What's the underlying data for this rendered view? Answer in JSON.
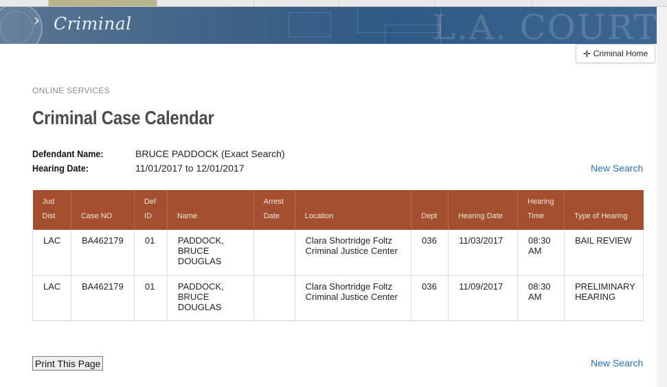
{
  "banner": {
    "section_title": "Criminal",
    "watermark": "L.A. COURT"
  },
  "home_button": {
    "icon": "crosshair-move-icon",
    "label": "Criminal Home"
  },
  "page": {
    "eyebrow": "ONLINE SERVICES",
    "title": "Criminal Case Calendar"
  },
  "search_info": {
    "defendant_label": "Defendant Name:",
    "defendant_value": "BRUCE PADDOCK (Exact Search)",
    "hearing_label": "Hearing Date:",
    "hearing_value": "11/01/2017 to 12/01/2017"
  },
  "links": {
    "new_search_top": "New Search",
    "new_search_bottom": "New Search"
  },
  "table": {
    "columns": [
      {
        "line1": "Jud",
        "line2": "Dist"
      },
      {
        "line1": "",
        "line2": "Case NO"
      },
      {
        "line1": "Def",
        "line2": "ID"
      },
      {
        "line1": "",
        "line2": "Name"
      },
      {
        "line1": "Arrest",
        "line2": "Date"
      },
      {
        "line1": "",
        "line2": "Location"
      },
      {
        "line1": "",
        "line2": "Dept"
      },
      {
        "line1": "",
        "line2": "Hearing Date"
      },
      {
        "line1": "Hearing",
        "line2": "Time"
      },
      {
        "line1": "",
        "line2": "Type of Hearing"
      }
    ],
    "rows": [
      {
        "jud_dist": "LAC",
        "case_no": "BA462179",
        "def_id": "01",
        "name_lines": [
          "PADDOCK,",
          "BRUCE",
          "DOUGLAS"
        ],
        "arrest_date": "",
        "location_lines": [
          "Clara Shortridge Foltz",
          "Criminal Justice Center"
        ],
        "dept": "036",
        "hearing_date": "11/03/2017",
        "time_lines": [
          "08:30",
          "AM"
        ],
        "type_lines": [
          "BAIL REVIEW"
        ]
      },
      {
        "jud_dist": "LAC",
        "case_no": "BA462179",
        "def_id": "01",
        "name_lines": [
          "PADDOCK,",
          "BRUCE",
          "DOUGLAS"
        ],
        "arrest_date": "",
        "location_lines": [
          "Clara Shortridge Foltz",
          "Criminal Justice Center"
        ],
        "dept": "036",
        "hearing_date": "11/09/2017",
        "time_lines": [
          "08:30",
          "AM"
        ],
        "type_lines": [
          "PRELIMINARY",
          "HEARING"
        ]
      }
    ]
  },
  "print_button": {
    "label": "Print This Page"
  },
  "colors": {
    "header_bg": "#a44f30",
    "link": "#1f73c9",
    "banner": "#2f5a86"
  }
}
